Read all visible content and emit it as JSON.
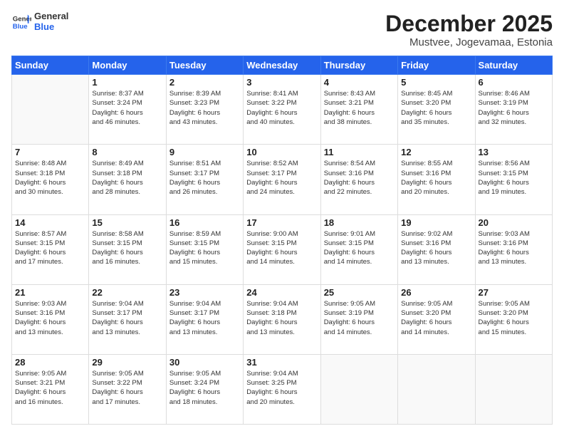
{
  "logo": {
    "line1": "General",
    "line2": "Blue"
  },
  "title": "December 2025",
  "subtitle": "Mustvee, Jogevamaa, Estonia",
  "weekdays": [
    "Sunday",
    "Monday",
    "Tuesday",
    "Wednesday",
    "Thursday",
    "Friday",
    "Saturday"
  ],
  "weeks": [
    [
      {
        "day": "",
        "info": ""
      },
      {
        "day": "1",
        "info": "Sunrise: 8:37 AM\nSunset: 3:24 PM\nDaylight: 6 hours\nand 46 minutes."
      },
      {
        "day": "2",
        "info": "Sunrise: 8:39 AM\nSunset: 3:23 PM\nDaylight: 6 hours\nand 43 minutes."
      },
      {
        "day": "3",
        "info": "Sunrise: 8:41 AM\nSunset: 3:22 PM\nDaylight: 6 hours\nand 40 minutes."
      },
      {
        "day": "4",
        "info": "Sunrise: 8:43 AM\nSunset: 3:21 PM\nDaylight: 6 hours\nand 38 minutes."
      },
      {
        "day": "5",
        "info": "Sunrise: 8:45 AM\nSunset: 3:20 PM\nDaylight: 6 hours\nand 35 minutes."
      },
      {
        "day": "6",
        "info": "Sunrise: 8:46 AM\nSunset: 3:19 PM\nDaylight: 6 hours\nand 32 minutes."
      }
    ],
    [
      {
        "day": "7",
        "info": "Sunrise: 8:48 AM\nSunset: 3:18 PM\nDaylight: 6 hours\nand 30 minutes."
      },
      {
        "day": "8",
        "info": "Sunrise: 8:49 AM\nSunset: 3:18 PM\nDaylight: 6 hours\nand 28 minutes."
      },
      {
        "day": "9",
        "info": "Sunrise: 8:51 AM\nSunset: 3:17 PM\nDaylight: 6 hours\nand 26 minutes."
      },
      {
        "day": "10",
        "info": "Sunrise: 8:52 AM\nSunset: 3:17 PM\nDaylight: 6 hours\nand 24 minutes."
      },
      {
        "day": "11",
        "info": "Sunrise: 8:54 AM\nSunset: 3:16 PM\nDaylight: 6 hours\nand 22 minutes."
      },
      {
        "day": "12",
        "info": "Sunrise: 8:55 AM\nSunset: 3:16 PM\nDaylight: 6 hours\nand 20 minutes."
      },
      {
        "day": "13",
        "info": "Sunrise: 8:56 AM\nSunset: 3:15 PM\nDaylight: 6 hours\nand 19 minutes."
      }
    ],
    [
      {
        "day": "14",
        "info": "Sunrise: 8:57 AM\nSunset: 3:15 PM\nDaylight: 6 hours\nand 17 minutes."
      },
      {
        "day": "15",
        "info": "Sunrise: 8:58 AM\nSunset: 3:15 PM\nDaylight: 6 hours\nand 16 minutes."
      },
      {
        "day": "16",
        "info": "Sunrise: 8:59 AM\nSunset: 3:15 PM\nDaylight: 6 hours\nand 15 minutes."
      },
      {
        "day": "17",
        "info": "Sunrise: 9:00 AM\nSunset: 3:15 PM\nDaylight: 6 hours\nand 14 minutes."
      },
      {
        "day": "18",
        "info": "Sunrise: 9:01 AM\nSunset: 3:15 PM\nDaylight: 6 hours\nand 14 minutes."
      },
      {
        "day": "19",
        "info": "Sunrise: 9:02 AM\nSunset: 3:16 PM\nDaylight: 6 hours\nand 13 minutes."
      },
      {
        "day": "20",
        "info": "Sunrise: 9:03 AM\nSunset: 3:16 PM\nDaylight: 6 hours\nand 13 minutes."
      }
    ],
    [
      {
        "day": "21",
        "info": "Sunrise: 9:03 AM\nSunset: 3:16 PM\nDaylight: 6 hours\nand 13 minutes."
      },
      {
        "day": "22",
        "info": "Sunrise: 9:04 AM\nSunset: 3:17 PM\nDaylight: 6 hours\nand 13 minutes."
      },
      {
        "day": "23",
        "info": "Sunrise: 9:04 AM\nSunset: 3:17 PM\nDaylight: 6 hours\nand 13 minutes."
      },
      {
        "day": "24",
        "info": "Sunrise: 9:04 AM\nSunset: 3:18 PM\nDaylight: 6 hours\nand 13 minutes."
      },
      {
        "day": "25",
        "info": "Sunrise: 9:05 AM\nSunset: 3:19 PM\nDaylight: 6 hours\nand 14 minutes."
      },
      {
        "day": "26",
        "info": "Sunrise: 9:05 AM\nSunset: 3:20 PM\nDaylight: 6 hours\nand 14 minutes."
      },
      {
        "day": "27",
        "info": "Sunrise: 9:05 AM\nSunset: 3:20 PM\nDaylight: 6 hours\nand 15 minutes."
      }
    ],
    [
      {
        "day": "28",
        "info": "Sunrise: 9:05 AM\nSunset: 3:21 PM\nDaylight: 6 hours\nand 16 minutes."
      },
      {
        "day": "29",
        "info": "Sunrise: 9:05 AM\nSunset: 3:22 PM\nDaylight: 6 hours\nand 17 minutes."
      },
      {
        "day": "30",
        "info": "Sunrise: 9:05 AM\nSunset: 3:24 PM\nDaylight: 6 hours\nand 18 minutes."
      },
      {
        "day": "31",
        "info": "Sunrise: 9:04 AM\nSunset: 3:25 PM\nDaylight: 6 hours\nand 20 minutes."
      },
      {
        "day": "",
        "info": ""
      },
      {
        "day": "",
        "info": ""
      },
      {
        "day": "",
        "info": ""
      }
    ]
  ]
}
